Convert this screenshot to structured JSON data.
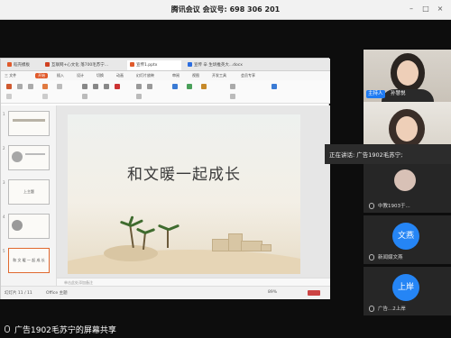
{
  "window": {
    "title_prefix": "腾讯会议",
    "meeting_label": "会议号:",
    "meeting_number": "698 306 201"
  },
  "wps": {
    "tabs": [
      {
        "label": "稻壳模板",
        "color": "#e05a2b"
      },
      {
        "label": "互联网+心文化 落700毛苏宁...",
        "color": "#d04020"
      },
      {
        "label": "宣传1.pptx",
        "color": "#e05a2b"
      },
      {
        "label": "宣传 辛 生圳推英大...docx",
        "color": "#2b6de0"
      }
    ],
    "menu": [
      "三 文件",
      "开始",
      "插入",
      "设计",
      "切换",
      "动画",
      "幻灯片放映",
      "审阅",
      "视图",
      "开发工具",
      "会员专享"
    ],
    "slide_numbers": [
      "1",
      "2",
      "3",
      "4",
      "5"
    ],
    "thumb_texts": [
      "",
      "",
      "上主题",
      "",
      "和 文 暖 一 起 成 长"
    ],
    "slide_title": "和文暖一起成长",
    "notes_placeholder": "单击此处添加备注",
    "status": {
      "slide_count": "幻灯片 11 / 11",
      "theme": "Office 主题",
      "zoom": "89%"
    }
  },
  "participants": {
    "host_tag": "主持人",
    "host_name": "孙慧悦",
    "speaking": "正在讲话: 广告1902毛苏宁;",
    "tiles": [
      {
        "name": "中教1903于...",
        "type": "image"
      },
      {
        "name": "新闻媒文燕",
        "avatar": "文燕"
      },
      {
        "name": "广告...2上岸",
        "avatar": "上岸"
      }
    ]
  },
  "share_status": "广告1902毛苏宁的屏幕共享",
  "colors": {
    "accent": "#1f7bf2",
    "wps_orange": "#e05a2b"
  }
}
